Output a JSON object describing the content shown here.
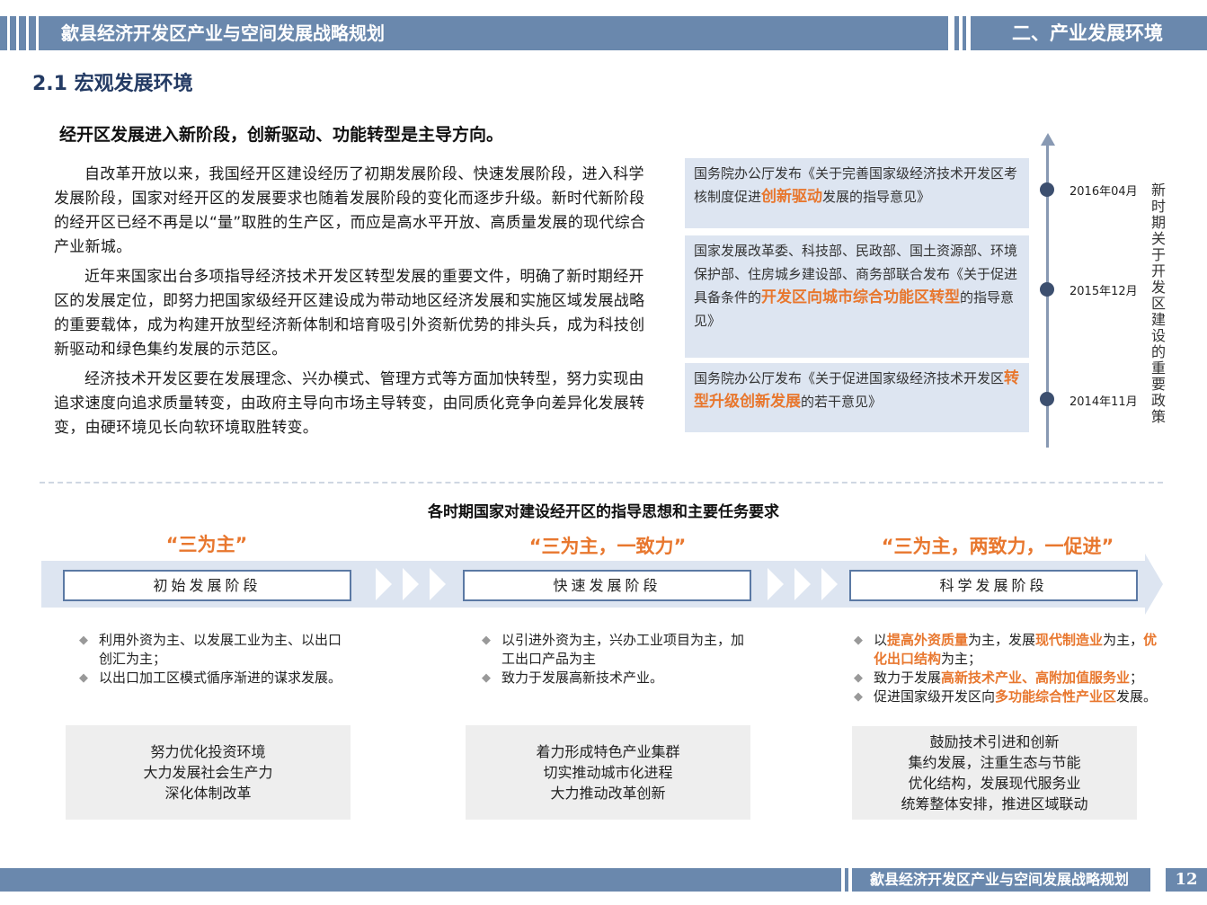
{
  "header": {
    "title": "歙县经济开发区产业与空间发展战略规划",
    "section": "二、产业发展环境"
  },
  "section_title": "2.1 宏观发展环境",
  "subtitle": "经开区发展进入新阶段，创新驱动、功能转型是主导方向。",
  "paragraphs": [
    "自改革开放以来，我国经开区建设经历了初期发展阶段、快速发展阶段，进入科学发展阶段，国家对经开区的发展要求也随着发展阶段的变化而逐步升级。新时代新阶段的经开区已经不再是以“量”取胜的生产区，而应是高水平开放、高质量发展的现代综合产业新城。",
    "近年来国家出台多项指导经济技术开发区转型发展的重要文件，明确了新时期经开区的发展定位，即努力把国家级经开区建设成为带动地区经济发展和实施区域发展战略的重要载体，成为构建开放型经济新体制和培育吸引外资新优势的排头兵，成为科技创新驱动和绿色集约发展的示范区。",
    "经济技术开发区要在发展理念、兴办模式、管理方式等方面加快转型，努力实现由追求速度向追求质量转变，由政府主导向市场主导转变，由同质化竞争向差异化发展转变，由硬环境见长向软环境取胜转变。"
  ],
  "policies": [
    {
      "date": "2016年04月",
      "pre": "国务院办公厅发布《关于完善国家级经济技术开发区考核制度促进",
      "hl": "创新驱动",
      "post": "发展的指导意见》"
    },
    {
      "date": "2015年12月",
      "pre": "国家发展改革委、科技部、民政部、国土资源部、环境保护部、住房城乡建设部、商务部联合发布《关于促进具备条件的",
      "hl": "开发区向城市综合功能区转型",
      "post": "的指导意见》"
    },
    {
      "date": "2014年11月",
      "pre": "国务院办公厅发布《关于促进国家级经济技术开发区",
      "hl": "转型升级创新发展",
      "post": "的若干意见》"
    }
  ],
  "timeline_label": "新时期关于开发区建设的重要政策",
  "stages_title": "各时期国家对建设经开区的指导思想和主要任务要求",
  "stages": [
    {
      "slogan": "“三为主”",
      "name": "初始发展阶段",
      "bullets": [
        [
          {
            "t": "利用外资为主、以发展工业为主、以出口创汇为主；"
          }
        ],
        [
          {
            "t": "以出口加工区模式循序渐进的谋求发展。"
          }
        ]
      ],
      "box": [
        "努力优化投资环境",
        "大力发展社会生产力",
        "深化体制改革"
      ]
    },
    {
      "slogan": "“三为主，一致力”",
      "name": "快速发展阶段",
      "bullets": [
        [
          {
            "t": "以引进外资为主，兴办工业项目为主，加工出口产品为主"
          }
        ],
        [
          {
            "t": "致力于发展高新技术产业。"
          }
        ]
      ],
      "box": [
        "着力形成特色产业集群",
        "切实推动城市化进程",
        "大力推动改革创新"
      ]
    },
    {
      "slogan": "“三为主，两致力，一促进”",
      "name": "科学发展阶段",
      "bullets": [
        [
          {
            "t": "以"
          },
          {
            "t": "提高外资质量",
            "o": 1
          },
          {
            "t": "为主，发展"
          },
          {
            "t": "现代制造业",
            "o": 1
          },
          {
            "t": "为主，"
          },
          {
            "t": "优化出口结构",
            "o": 1
          },
          {
            "t": "为主；"
          }
        ],
        [
          {
            "t": "致力于发展"
          },
          {
            "t": "高新技术产业、高附加值服务业",
            "o": 1
          },
          {
            "t": "；"
          }
        ],
        [
          {
            "t": "促进国家级开发区向"
          },
          {
            "t": "多功能综合性产业区",
            "o": 1
          },
          {
            "t": "发展。"
          }
        ]
      ],
      "box": [
        "鼓励技术引进和创新",
        "集约发展，注重生态与节能",
        "优化结构，发展现代服务业",
        "统筹整体安排，推进区域联动"
      ]
    }
  ],
  "footer": {
    "title": "歙县经济开发区产业与空间发展战略规划",
    "page": "12"
  },
  "colors": {
    "header": "#6a88ad",
    "accent": "#e8772e",
    "panel": "#dde5f1"
  }
}
